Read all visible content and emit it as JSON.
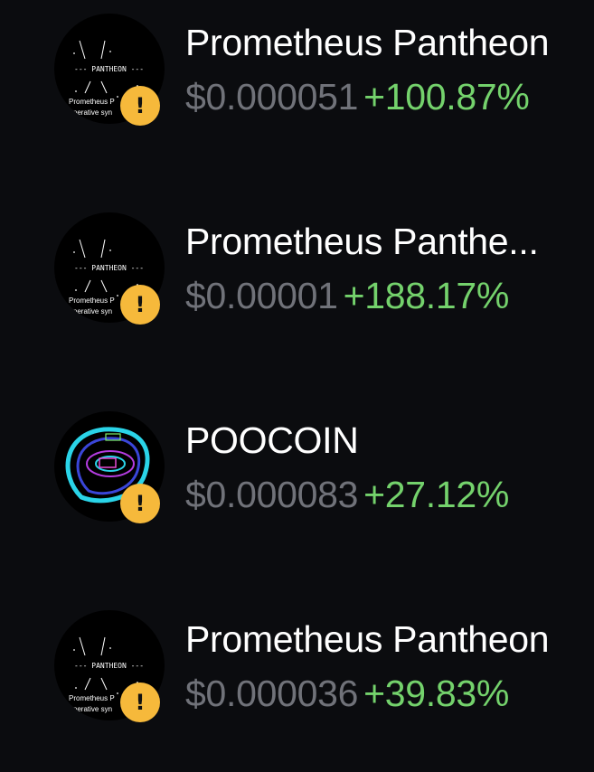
{
  "tokens": [
    {
      "name": "Prometheus Pantheon",
      "price": "$0.000051",
      "change": "+100.87%",
      "logo_text_1": "--- PANTHEON ---",
      "logo_text_2": "Prometheus P",
      "logo_text_3": "ooperative syn",
      "badge": "!"
    },
    {
      "name": "Prometheus Panthe...",
      "price": "$0.00001",
      "change": "+188.17%",
      "logo_text_1": "--- PANTHEON ---",
      "logo_text_2": "Prometheus P",
      "logo_text_3": "ooperative syn",
      "badge": "!"
    },
    {
      "name": "POOCOIN",
      "price": "$0.000083",
      "change": "+27.12%",
      "badge": "!"
    },
    {
      "name": "Prometheus Pantheon",
      "price": "$0.000036",
      "change": "+39.83%",
      "logo_text_1": "--- PANTHEON ---",
      "logo_text_2": "Prometheus P",
      "logo_text_3": "ooperative syn",
      "badge": "!"
    }
  ],
  "colors": {
    "background": "#0b0c0f",
    "name": "#ffffff",
    "price": "#707279",
    "change_positive": "#74d26c",
    "warning_badge": "#f6b93b"
  },
  "icons": {
    "warning": "warning-icon",
    "pantheon_logo": "pantheon-logo",
    "poocoin_logo": "poocoin-logo"
  }
}
